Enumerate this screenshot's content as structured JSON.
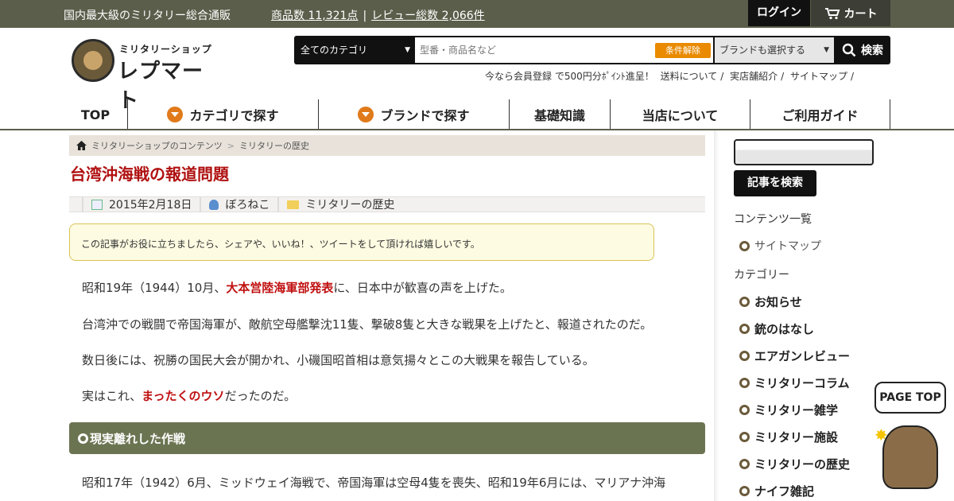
{
  "topbar": {
    "tagline": "国内最大級のミリタリー総合通販",
    "product_count": "商品数 11,321点",
    "separator": "|",
    "review_count": "レビュー総数 2,066件",
    "login": "ログイン",
    "cart": "カート"
  },
  "logo": {
    "small": "ミリタリーショップ",
    "big": "レプマート"
  },
  "search": {
    "category": "全てのカテゴリ",
    "placeholder": "型番・商品名など",
    "clear": "条件解除",
    "brand": "ブランドも選択する",
    "submit": "検索"
  },
  "sublinks": [
    "今なら会員登録 で500円分ﾎﾟｲﾝﾄ進呈！",
    "送料について",
    "実店舗紹介",
    "サイトマップ"
  ],
  "nav": [
    "TOP",
    "カテゴリで探す",
    "ブランドで探す",
    "基礎知識",
    "当店について",
    "ご利用ガイド"
  ],
  "breadcrumb": {
    "home": "ミリタリーショップのコンテンツ",
    "sep": ">",
    "current": "ミリタリーの歴史"
  },
  "article": {
    "title": "台湾沖海戦の報道問題",
    "date": "2015年2月18日",
    "author": "ぼろねこ",
    "category": "ミリタリーの歴史",
    "notice": "この記事がお役に立ちましたら、シェアや、いいね！、ツイートをして頂ければ嬉しいです。",
    "p1_a": "昭和19年（1944）10月、",
    "p1_em": "大本営陸海軍部発表",
    "p1_b": "に、日本中が歓喜の声を上げた。",
    "p2": "台湾沖での戦闘で帝国海軍が、敵航空母艦撃沈11隻、撃破8隻と大きな戦果を上げたと、報道されたのだ。",
    "p3": "数日後には、祝勝の国民大会が開かれ、小磯国昭首相は意気揚々とこの大戦果を報告している。",
    "p4_a": "実はこれ、",
    "p4_em": "まったくのウソ",
    "p4_b": "だったのだ。",
    "section": "現実離れした作戦",
    "p5": "昭和17年（1942）6月、ミッドウェイ海戦で、帝国海軍は空母4隻を喪失、昭和19年6月には、マリアナ沖海"
  },
  "sidebar": {
    "search_button": "記事を検索",
    "contents_heading": "コンテンツ一覧",
    "contents": [
      "サイトマップ"
    ],
    "category_heading": "カテゴリー",
    "categories": [
      "お知らせ",
      "銃のはなし",
      "エアガンレビュー",
      "ミリタリーコラム",
      "ミリタリー雑学",
      "ミリタリー施設",
      "ミリタリーの歴史",
      "ナイフ雑記"
    ]
  },
  "pagetop": "PAGE TOP",
  "colors": {
    "topbar": "#5b5e4a",
    "title_red": "#b01010",
    "section_bar": "#6b7451",
    "accent_orange": "#e98a00"
  }
}
